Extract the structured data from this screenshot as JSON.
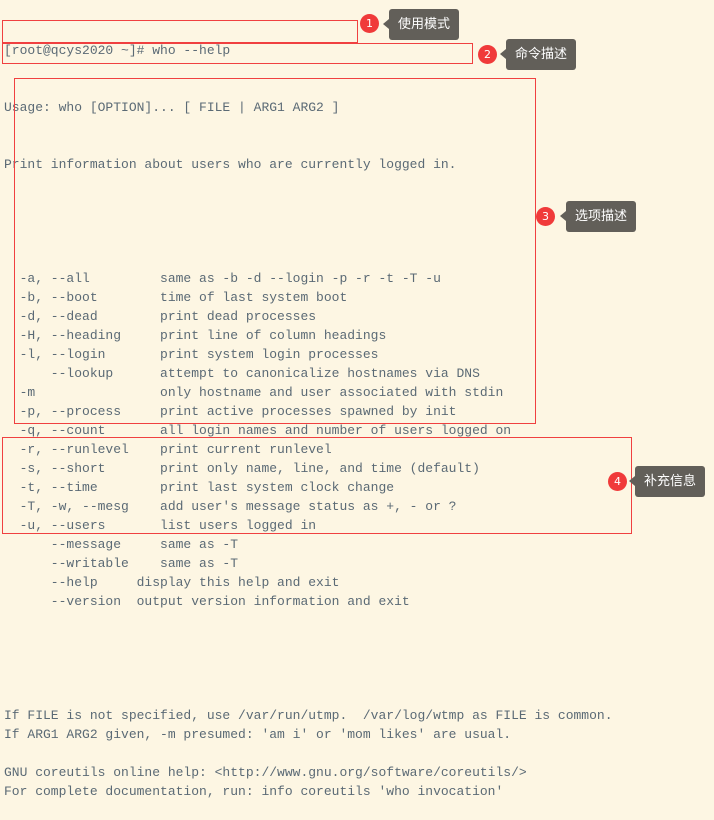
{
  "terminal": {
    "prompt_line": "[root@qcys2020 ~]# who --help",
    "usage": "Usage: who [OPTION]... [ FILE | ARG1 ARG2 ]",
    "description": "Print information about users who are currently logged in.",
    "options": [
      "  -a, --all         same as -b -d --login -p -r -t -T -u",
      "  -b, --boot        time of last system boot",
      "  -d, --dead        print dead processes",
      "  -H, --heading     print line of column headings",
      "  -l, --login       print system login processes",
      "      --lookup      attempt to canonicalize hostnames via DNS",
      "  -m                only hostname and user associated with stdin",
      "  -p, --process     print active processes spawned by init",
      "  -q, --count       all login names and number of users logged on",
      "  -r, --runlevel    print current runlevel",
      "  -s, --short       print only name, line, and time (default)",
      "  -t, --time        print last system clock change",
      "  -T, -w, --mesg    add user's message status as +, - or ?",
      "  -u, --users       list users logged in",
      "      --message     same as -T",
      "      --writable    same as -T",
      "      --help     display this help and exit",
      "      --version  output version information and exit"
    ],
    "notes": [
      "If FILE is not specified, use /var/run/utmp.  /var/log/wtmp as FILE is common.",
      "If ARG1 ARG2 given, -m presumed: 'am i' or 'mom likes' are usual.",
      "",
      "GNU coreutils online help: <http://www.gnu.org/software/coreutils/>",
      "For complete documentation, run: info coreutils 'who invocation'"
    ]
  },
  "annotations": [
    {
      "number": "1",
      "label": "使用模式"
    },
    {
      "number": "2",
      "label": "命令描述"
    },
    {
      "number": "3",
      "label": "选项描述"
    },
    {
      "number": "4",
      "label": "补充信息"
    }
  ],
  "colors": {
    "background": "#fdf6e3",
    "text": "#5b6a75",
    "highlight_box": "#f04040",
    "badge": "#f03a3a",
    "tag": "#625f59"
  }
}
